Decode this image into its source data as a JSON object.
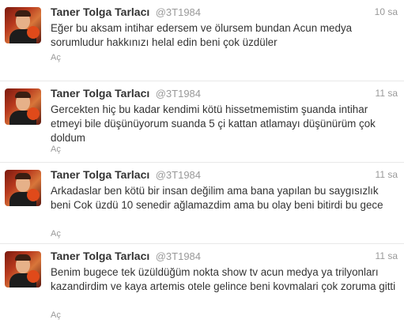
{
  "tweets": [
    {
      "name": "Taner Tolga Tarlacı",
      "handle": "@3T1984",
      "time": "10 sa",
      "text": "Eğer bu aksam intihar edersem ve ölursem bundan Acun medya sorumludur hakkınızı helal edin beni çok üzdüler",
      "expand": "Aç"
    },
    {
      "name": "Taner Tolga Tarlacı",
      "handle": "@3T1984",
      "time": "11 sa",
      "text": "Gercekten hiç bu kadar kendimi kötü hissetmemistim şuanda intihar etmeyi bile düşünüyorum suanda 5 çi kattan atlamayı düşünürüm çok doldum",
      "expand": "Aç"
    },
    {
      "name": "Taner Tolga Tarlacı",
      "handle": "@3T1984",
      "time": "11 sa",
      "text": "Arkadaslar ben kötü bir insan değilim ama bana yapılan bu saygısızlık beni Cok üzdü 10 senedir ağlamazdim ama bu olay beni bitirdi bu gece",
      "expand": "Aç"
    },
    {
      "name": "Taner Tolga Tarlacı",
      "handle": "@3T1984",
      "time": "11 sa",
      "text": "Benim bugece tek üzüldüğüm nokta show tv acun medya ya trilyonları kazandirdim ve kaya artemis otele gelince beni kovmalari çok zoruma gitti",
      "expand": "Aç"
    }
  ]
}
